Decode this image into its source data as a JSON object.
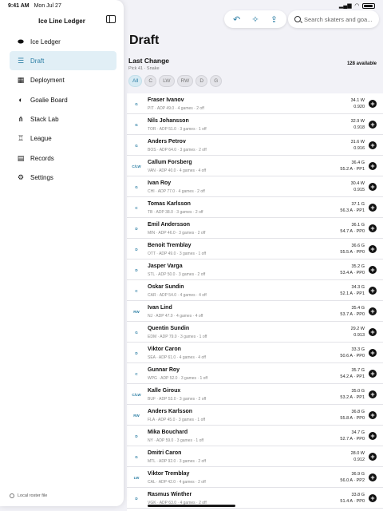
{
  "status": {
    "time": "9:41 AM",
    "date": "Mon Jul 27",
    "battery": "100%"
  },
  "sidebar": {
    "title": "Ice Line Ledger",
    "items": [
      {
        "label": "Ice Ledger",
        "icon": "hockey-puck-icon"
      },
      {
        "label": "Draft",
        "icon": "list-icon"
      },
      {
        "label": "Deployment",
        "icon": "grid-icon"
      },
      {
        "label": "Goalie Board",
        "icon": "shield-icon"
      },
      {
        "label": "Stack Lab",
        "icon": "network-icon"
      },
      {
        "label": "League",
        "icon": "trophy-icon"
      },
      {
        "label": "Records",
        "icon": "book-icon"
      },
      {
        "label": "Settings",
        "icon": "gear-icon"
      }
    ],
    "footer": "Local roster file"
  },
  "search": {
    "placeholder": "Search skaters and goa..."
  },
  "main": {
    "title": "Draft",
    "section_title": "Last Change",
    "section_sub": "Pick 41 · Snake",
    "available": "128 available",
    "filters": [
      "All",
      "C",
      "LW",
      "RW",
      "D",
      "G"
    ]
  },
  "players": [
    {
      "pos": "G",
      "name": "Fraser Ivanov",
      "meta": "PIT · ADP 49.0 · 4 games · 2 off",
      "stat1": "34.1 W",
      "stat2": "0.920"
    },
    {
      "pos": "G",
      "name": "Nils Johansson",
      "meta": "TOR · ADP 51.0 · 3 games · 1 off",
      "stat1": "32.9 W",
      "stat2": "0.918"
    },
    {
      "pos": "G",
      "name": "Anders Petrov",
      "meta": "BOS · ADP 64.0 · 3 games · 2 off",
      "stat1": "31.6 W",
      "stat2": "0.916"
    },
    {
      "pos": "C/LW",
      "name": "Callum Forsberg",
      "meta": "VAN · ADP 40.0 · 4 games · 4 off",
      "stat1": "36.4 G",
      "stat2": "55.2 A · PP1"
    },
    {
      "pos": "G",
      "name": "Ivan Roy",
      "meta": "CHI · ADP 77.0 · 4 games · 2 off",
      "stat1": "30.4 W",
      "stat2": "0.915"
    },
    {
      "pos": "C",
      "name": "Tomas Karlsson",
      "meta": "TB · ADP 38.0 · 3 games · 2 off",
      "stat1": "37.1 G",
      "stat2": "56.3 A · PP1"
    },
    {
      "pos": "D",
      "name": "Emil Andersson",
      "meta": "MIN · ADP 46.0 · 3 games · 2 off",
      "stat1": "36.1 G",
      "stat2": "54.7 A · PP0"
    },
    {
      "pos": "D",
      "name": "Benoit Tremblay",
      "meta": "OTT · ADP 49.0 · 3 games · 1 off",
      "stat1": "36.6 G",
      "stat2": "55.5 A · PP0"
    },
    {
      "pos": "D",
      "name": "Jasper Varga",
      "meta": "STL · ADP 50.0 · 3 games · 2 off",
      "stat1": "35.2 G",
      "stat2": "53.4 A · PP0"
    },
    {
      "pos": "C",
      "name": "Oskar Sundin",
      "meta": "CAR · ADP 54.0 · 4 games · 4 off",
      "stat1": "34.3 G",
      "stat2": "52.1 A · PP1"
    },
    {
      "pos": "RW",
      "name": "Ivan Lind",
      "meta": "NJ · ADP 47.0 · 4 games · 4 off",
      "stat1": "35.4 G",
      "stat2": "53.7 A · PP0"
    },
    {
      "pos": "G",
      "name": "Quentin Sundin",
      "meta": "EDM · ADP 79.0 · 3 games · 1 off",
      "stat1": "29.2 W",
      "stat2": "0.913"
    },
    {
      "pos": "D",
      "name": "Viktor Caron",
      "meta": "SEA · ADP 61.0 · 4 games · 4 off",
      "stat1": "33.3 G",
      "stat2": "50.6 A · PP0"
    },
    {
      "pos": "C",
      "name": "Gunnar Roy",
      "meta": "WPG · ADP 52.0 · 3 games · 1 off",
      "stat1": "35.7 G",
      "stat2": "54.2 A · PP1"
    },
    {
      "pos": "C/LW",
      "name": "Kalle Giroux",
      "meta": "BUF · ADP 53.0 · 3 games · 2 off",
      "stat1": "35.0 G",
      "stat2": "53.2 A · PP1"
    },
    {
      "pos": "RW",
      "name": "Anders Karlsson",
      "meta": "FLA · ADP 45.0 · 3 games · 1 off",
      "stat1": "36.8 G",
      "stat2": "55.8 A · PP0"
    },
    {
      "pos": "D",
      "name": "Mika Bouchard",
      "meta": "NY · ADP 59.0 · 3 games · 1 off",
      "stat1": "34.7 G",
      "stat2": "52.7 A · PP0"
    },
    {
      "pos": "G",
      "name": "Dmitri Caron",
      "meta": "MTL · ADP 92.0 · 3 games · 2 off",
      "stat1": "28.0 W",
      "stat2": "0.912"
    },
    {
      "pos": "LW",
      "name": "Viktor Tremblay",
      "meta": "CAL · ADP 42.0 · 4 games · 2 off",
      "stat1": "36.9 G",
      "stat2": "56.0 A · PP2"
    },
    {
      "pos": "D",
      "name": "Rasmus Winther",
      "meta": "VGK · ADP 63.0 · 4 games · 2 off",
      "stat1": "33.8 G",
      "stat2": "51.4 A · PP0"
    }
  ],
  "colors": {
    "accent": "#2d7fa5",
    "active_bg": "#e1eff6",
    "page_bg": "#f2f2f7"
  }
}
